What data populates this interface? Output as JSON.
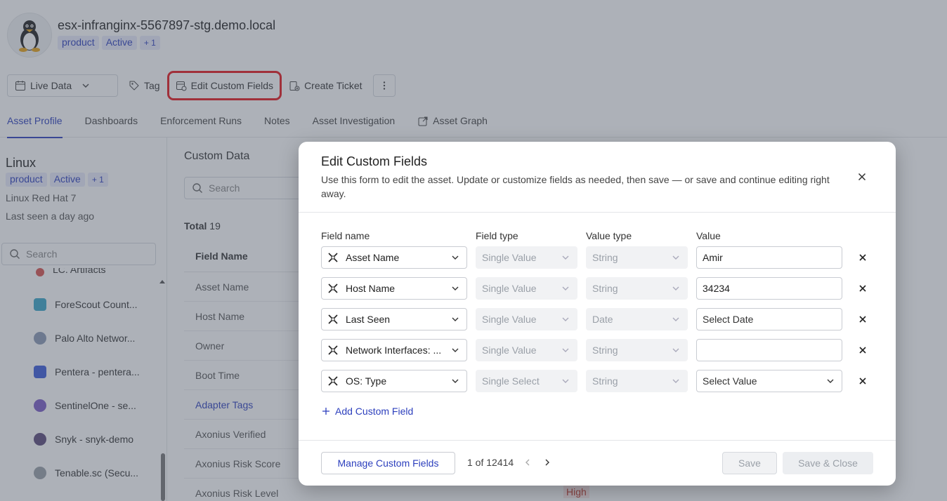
{
  "asset": {
    "hostname": "esx-infranginx-5567897-stg.demo.local",
    "chips": [
      "product",
      "Active",
      "+ 1"
    ]
  },
  "toolbar": {
    "live_data": "Live Data",
    "tag": "Tag",
    "edit_custom_fields": "Edit Custom Fields",
    "create_ticket": "Create Ticket"
  },
  "tabs": [
    {
      "label": "Asset Profile"
    },
    {
      "label": "Dashboards"
    },
    {
      "label": "Enforcement Runs"
    },
    {
      "label": "Notes"
    },
    {
      "label": "Asset Investigation"
    },
    {
      "label": "Asset Graph"
    }
  ],
  "sidebar": {
    "os": "Linux",
    "chips": [
      "product",
      "Active",
      "+ 1"
    ],
    "os_version": "Linux Red Hat 7",
    "last_seen": "Last seen a day ago",
    "search_placeholder": "Search",
    "adapters": [
      {
        "label": "LC. Artifacts",
        "color": "#d9534f"
      },
      {
        "label": "ForeScout Count...",
        "color": "#3aa6c9"
      },
      {
        "label": "Palo Alto Networ...",
        "color": "#8b9ab5"
      },
      {
        "label": "Pentera - pentera...",
        "color": "#3b5bdb"
      },
      {
        "label": "SentinelOne - se...",
        "color": "#7a5cc7"
      },
      {
        "label": "Snyk - snyk-demo",
        "color": "#5c4a7a"
      },
      {
        "label": "Tenable.sc (Secu...",
        "color": "#9aa0a8"
      }
    ]
  },
  "custom_data": {
    "title": "Custom Data",
    "search_placeholder": "Search",
    "total_label": "Total",
    "total_count": "19",
    "column_header": "Field Name",
    "rows": [
      "Asset Name",
      "Host Name",
      "Owner",
      "Boot Time",
      "Adapter Tags",
      "Axonius Verified",
      "Axonius Risk Score",
      "Axonius Risk Level"
    ],
    "risk_level_value": "High"
  },
  "modal": {
    "title": "Edit Custom Fields",
    "description": "Use this form to edit the asset. Update or customize fields as needed, then save — or save and continue editing right away.",
    "columns": {
      "field_name": "Field name",
      "field_type": "Field type",
      "value_type": "Value type",
      "value": "Value"
    },
    "fields": [
      {
        "name": "Asset Name",
        "field_type": "Single Value",
        "value_type": "String",
        "value": "Amir",
        "placeholder": "",
        "value_is_select": false
      },
      {
        "name": "Host Name",
        "field_type": "Single Value",
        "value_type": "String",
        "value": "34234",
        "placeholder": "",
        "value_is_select": false
      },
      {
        "name": "Last Seen",
        "field_type": "Single Value",
        "value_type": "Date",
        "value": "",
        "placeholder": "Select Date",
        "value_is_select": false
      },
      {
        "name": "Network Interfaces: ...",
        "field_type": "Single Value",
        "value_type": "String",
        "value": "",
        "placeholder": "",
        "value_is_select": false
      },
      {
        "name": "OS: Type",
        "field_type": "Single Select",
        "value_type": "String",
        "value": "",
        "placeholder": "Select Value",
        "value_is_select": true
      }
    ],
    "add_field": "Add Custom Field",
    "manage_button": "Manage Custom Fields",
    "pager": "1 of 12414",
    "save": "Save",
    "save_close": "Save & Close"
  },
  "colors": {
    "accent": "#2c3fbd",
    "highlight": "#e8141b",
    "overlay": "rgba(74,82,98,0.45)"
  }
}
